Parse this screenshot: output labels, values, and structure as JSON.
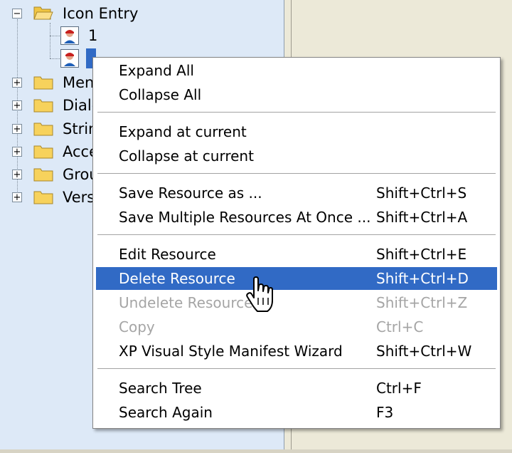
{
  "tree": {
    "root": {
      "label": "Icon Entry",
      "expander": "−"
    },
    "children": [
      {
        "label": "1"
      },
      {
        "label": ""
      }
    ],
    "folders": [
      {
        "label": "Menu",
        "expander": "+"
      },
      {
        "label": "Dialog",
        "expander": "+"
      },
      {
        "label": "String",
        "expander": "+"
      },
      {
        "label": "Accelerators",
        "expander": "+"
      },
      {
        "label": "Group",
        "expander": "+"
      },
      {
        "label": "Version",
        "expander": "+"
      }
    ]
  },
  "menu": {
    "items": [
      {
        "label": "Expand All",
        "shortcut": ""
      },
      {
        "label": "Collapse All",
        "shortcut": ""
      },
      {
        "label": "Expand at current",
        "shortcut": ""
      },
      {
        "label": "Collapse at current",
        "shortcut": ""
      },
      {
        "label": "Save Resource as ...",
        "shortcut": "Shift+Ctrl+S"
      },
      {
        "label": "Save Multiple Resources At Once ...",
        "shortcut": "Shift+Ctrl+A"
      },
      {
        "label": "Edit Resource",
        "shortcut": "Shift+Ctrl+E"
      },
      {
        "label": "Delete Resource",
        "shortcut": "Shift+Ctrl+D",
        "state": "selected"
      },
      {
        "label": "Undelete Resource",
        "shortcut": "Shift+Ctrl+Z",
        "state": "disabled"
      },
      {
        "label": "Copy",
        "shortcut": "Ctrl+C",
        "state": "disabled"
      },
      {
        "label": "XP Visual Style Manifest Wizard",
        "shortcut": "Shift+Ctrl+W"
      },
      {
        "label": "Search Tree",
        "shortcut": "Ctrl+F"
      },
      {
        "label": "Search Again",
        "shortcut": "F3"
      }
    ]
  },
  "colors": {
    "tree_bg": "#dde9f7",
    "panel_bg": "#ece9d8",
    "highlight": "#316ac5",
    "disabled_text": "#a5a5a5",
    "folder_fill": "#f7d25c"
  },
  "icons": {
    "folder_open": "folder-open-icon",
    "folder": "folder-icon",
    "resource": "icon-resource-icon",
    "cursor": "hand-pointer-cursor"
  }
}
